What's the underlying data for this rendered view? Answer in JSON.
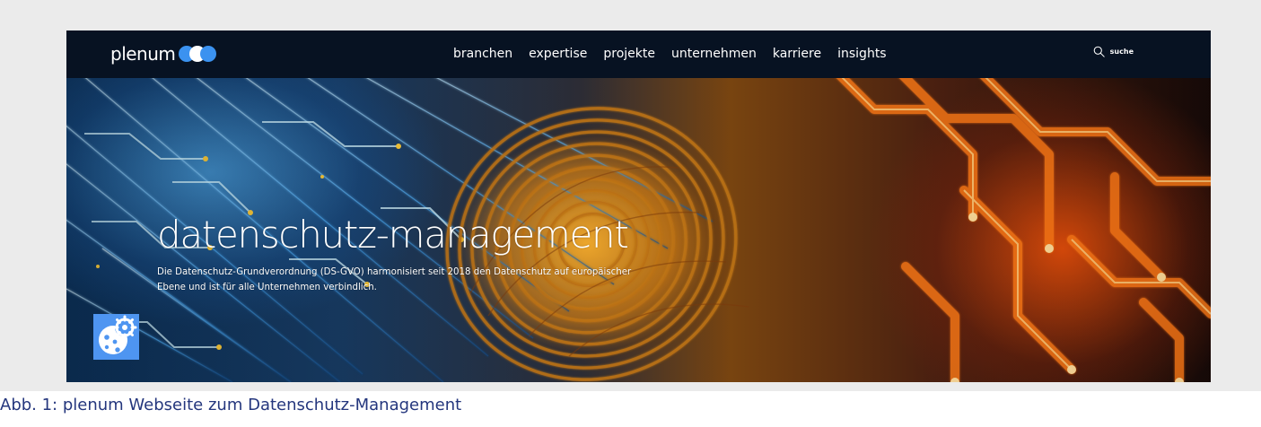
{
  "brand": {
    "name": "plenum",
    "accent_color": "#3b92f0"
  },
  "nav": {
    "items": [
      "branchen",
      "expertise",
      "projekte",
      "unternehmen",
      "karriere",
      "insights"
    ],
    "search": {
      "label": "suche",
      "icon": "search-icon"
    }
  },
  "hero": {
    "title": "datenschutz-management",
    "description": "Die Datenschutz-Grundverordnung (DS-GVO) harmonisiert seit 2018 den Datenschutz auf europäischer Ebene und ist für alle Unternehmen verbindlich.",
    "image_subject": "fingerprint and illuminated circuit lines"
  },
  "cookie_settings": {
    "icon": "cookie-gear-icon",
    "accent_color": "#4e95f1"
  },
  "caption": {
    "text": "Abb. 1: plenum Webseite zum Datenschutz-Management",
    "color": "#24367d"
  }
}
